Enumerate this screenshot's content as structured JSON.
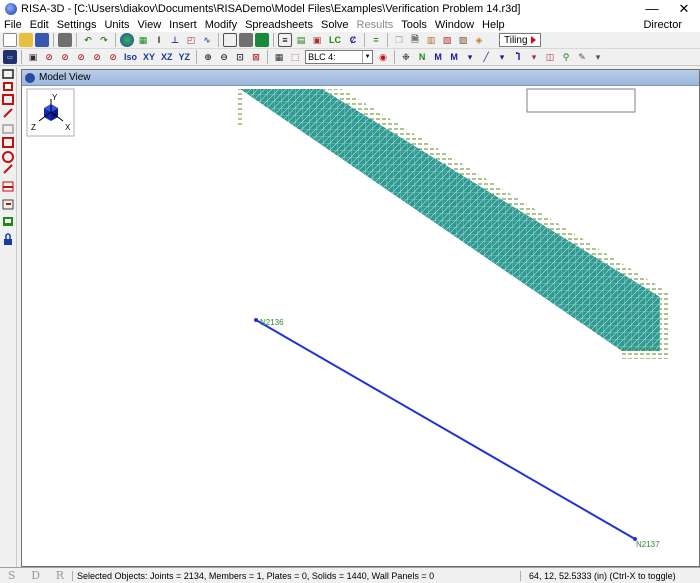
{
  "window": {
    "title": "RISA-3D - [C:\\Users\\diakov\\Documents\\RISADemo\\Model Files\\Examples\\Verification Problem 14.r3d]",
    "minimize_glyph": "—",
    "close_glyph": "✕"
  },
  "menu": {
    "items": [
      {
        "label": "File"
      },
      {
        "label": "Edit"
      },
      {
        "label": "Settings"
      },
      {
        "label": "Units"
      },
      {
        "label": "View"
      },
      {
        "label": "Insert"
      },
      {
        "label": "Modify"
      },
      {
        "label": "Spreadsheets"
      },
      {
        "label": "Solve"
      },
      {
        "label": "Results",
        "disabled": true
      },
      {
        "label": "Tools"
      },
      {
        "label": "Window"
      },
      {
        "label": "Help"
      }
    ],
    "right_label": "Director"
  },
  "toolbar": {
    "tiling_label": "Tiling",
    "view_iso": "Iso",
    "view_xy": "XY",
    "view_xz": "XZ",
    "view_yz": "YZ",
    "lc_label": "LC",
    "blc_value": "BLC 4:"
  },
  "model_view": {
    "title": "Model View",
    "axis": {
      "y": "Y",
      "z": "Z",
      "x": "X"
    },
    "node_start": "N2136",
    "node_end": "N2137",
    "colors": {
      "mesh_fill": "#2e9a92",
      "mesh_line": "#bfe3df",
      "mesh_edge_label": "#5a8a1a",
      "member": "#1f33d6",
      "node_label": "#2e8a2e"
    }
  },
  "status": {
    "sdr": [
      "S",
      "D",
      "R"
    ],
    "selected": "Selected Objects:  Joints = 2134,  Members = 1,  Plates = 0,  Solids = 1440,  Wall Panels = 0",
    "coords": "64, 12, 52.5333 (in)    (Ctrl-X to toggle)"
  }
}
